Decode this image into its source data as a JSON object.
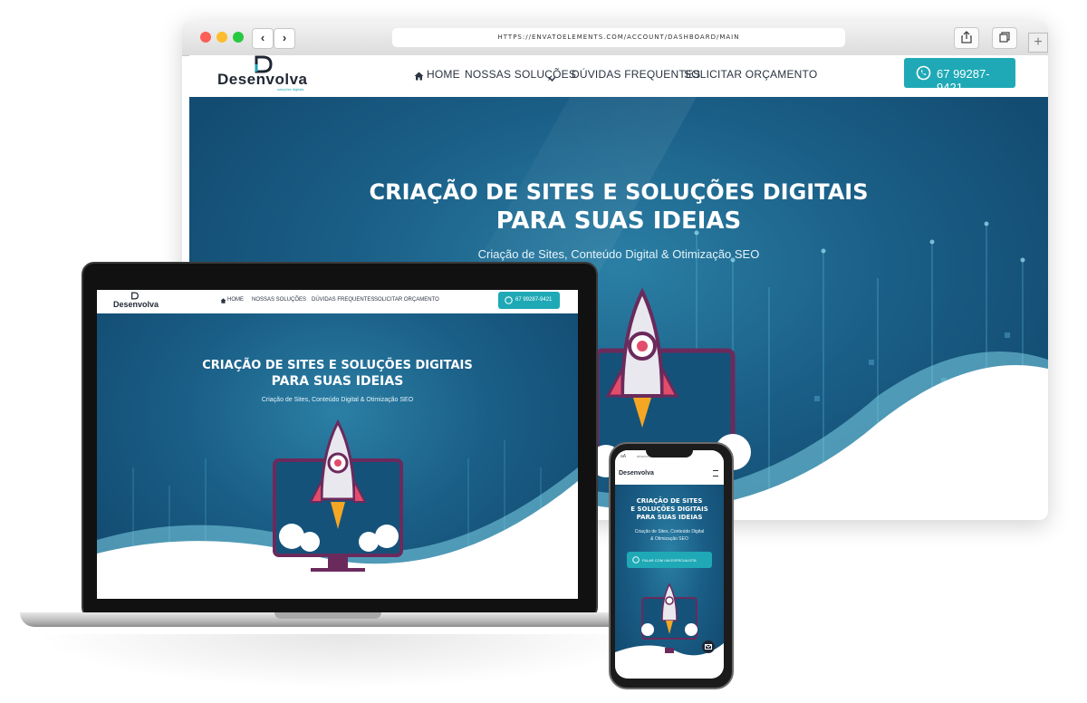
{
  "browser": {
    "url": "HTTPS://ENVATOELEMENTS.COM/ACCOUNT/DASHBOARD/MAIN",
    "back_icon": "‹",
    "forward_icon": "›",
    "share_icon": "share-icon",
    "tabs_icon": "tabs-icon",
    "new_tab_icon": "+"
  },
  "site": {
    "logo_text": "Desenvolva",
    "logo_tagline": "soluções digitais",
    "nav": {
      "home": "HOME",
      "solucoes": "NOSSAS SOLUÇÕES",
      "duvidas": "DÚVIDAS FREQUENTES",
      "orcamento": "SOLICITAR ORÇAMENTO"
    },
    "whatsapp_label": "67 99287-9421",
    "hero": {
      "title_line1": "CRIAÇÃO DE SITES E SOLUÇÕES DIGITAIS",
      "title_line2": "PARA SUAS IDEIAS",
      "subtitle": "Criação de Sites, Conteúdo Digital & Otimização SEO"
    }
  },
  "mobile": {
    "url": "desenvolvaweb.com.br",
    "title_line1": "CRIAÇÃO DE SITES",
    "title_line2": "E SOLUÇÕES DIGITAIS",
    "title_line3": "PARA SUAS IDEIAS",
    "subtitle_line1": "Criação de Sites, Conteúdo Digital",
    "subtitle_line2": "& Otimização SEO",
    "cta_label": "FALAR COM UM ESPECIALISTA",
    "aa_label": "aA"
  },
  "colors": {
    "accent": "#1fa9b6",
    "hero_dark": "#134c72",
    "rocket_purple": "#6b2a5c",
    "rocket_orange": "#f5a623"
  }
}
